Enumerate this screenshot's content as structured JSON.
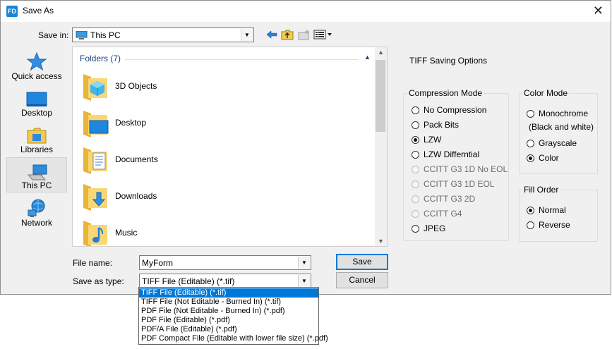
{
  "window": {
    "title": "Save As",
    "app_icon": "FD",
    "close_glyph": "✕"
  },
  "toolbar": {
    "save_in_label": "Save in:",
    "location": "This PC"
  },
  "places": [
    {
      "label": "Quick access",
      "icon": "star-icon"
    },
    {
      "label": "Desktop",
      "icon": "desktop-icon"
    },
    {
      "label": "Libraries",
      "icon": "libraries-icon"
    },
    {
      "label": "This PC",
      "icon": "computer-icon"
    },
    {
      "label": "Network",
      "icon": "network-icon"
    }
  ],
  "files": {
    "group_header": "Folders (7)",
    "items": [
      "3D Objects",
      "Desktop",
      "Documents",
      "Downloads",
      "Music"
    ]
  },
  "form": {
    "file_name_label": "File name:",
    "file_name_value": "MyForm",
    "save_type_label": "Save as type:",
    "save_type_value": "TIFF File (Editable) (*.tif)",
    "save_button": "Save",
    "cancel_button": "Cancel"
  },
  "type_options": [
    "TIFF File (Editable) (*.tif)",
    "TIFF File (Not Editable - Burned In) (*.tif)",
    "PDF File (Not Editable - Burned In) (*.pdf)",
    "PDF File (Editable) (*.pdf)",
    "PDF/A File (Editable) (*.pdf)",
    "PDF Compact File (Editable with lower file size) (*.pdf)"
  ],
  "options": {
    "title": "TIFF Saving Options",
    "compression": {
      "legend": "Compression Mode",
      "items": [
        "No Compression",
        "Pack Bits",
        "LZW",
        "LZW Differntial",
        "CCITT G3 1D No EOL",
        "CCITT G3 1D EOL",
        "CCITT G3 2D",
        "CCITT G4",
        "JPEG"
      ],
      "selected": "LZW"
    },
    "color": {
      "legend": "Color Mode",
      "monochrome_line1": "Monochrome",
      "monochrome_line2": "(Black and white)",
      "grayscale": "Grayscale",
      "color": "Color",
      "selected": "Color"
    },
    "fill": {
      "legend": "Fill Order",
      "normal": "Normal",
      "reverse": "Reverse",
      "selected": "Normal"
    }
  },
  "colors": {
    "accent": "#0078d7",
    "folder": "#f8d775",
    "header_text": "#1e3f7a"
  }
}
